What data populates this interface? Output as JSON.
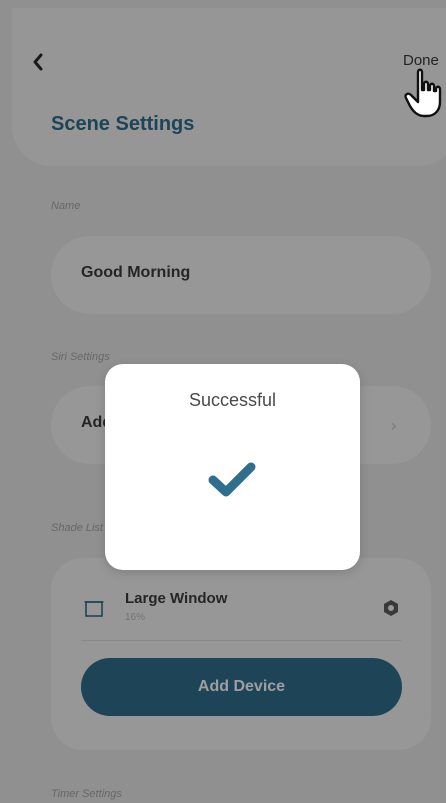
{
  "header": {
    "done_label": "Done",
    "title": "Scene Settings"
  },
  "name_section": {
    "label": "Name",
    "value": "Good Morning"
  },
  "siri_section": {
    "label": "Siri Settings",
    "value": "Add"
  },
  "shade_section": {
    "label": "Shade List",
    "shade": {
      "name": "Large Window",
      "position": "16%"
    },
    "add_device_label": "Add Device"
  },
  "timer_section": {
    "label": "Timer Settings"
  },
  "modal": {
    "title": "Successful"
  },
  "icons": {
    "back": "chevron-left-icon",
    "cursor": "hand-pointer-icon",
    "window": "window-shade-icon",
    "gear": "gear-icon",
    "check": "checkmark-icon"
  },
  "colors": {
    "accent": "#2f6f8d",
    "check": "#2f6f8d",
    "background": "#e9e9e9"
  }
}
